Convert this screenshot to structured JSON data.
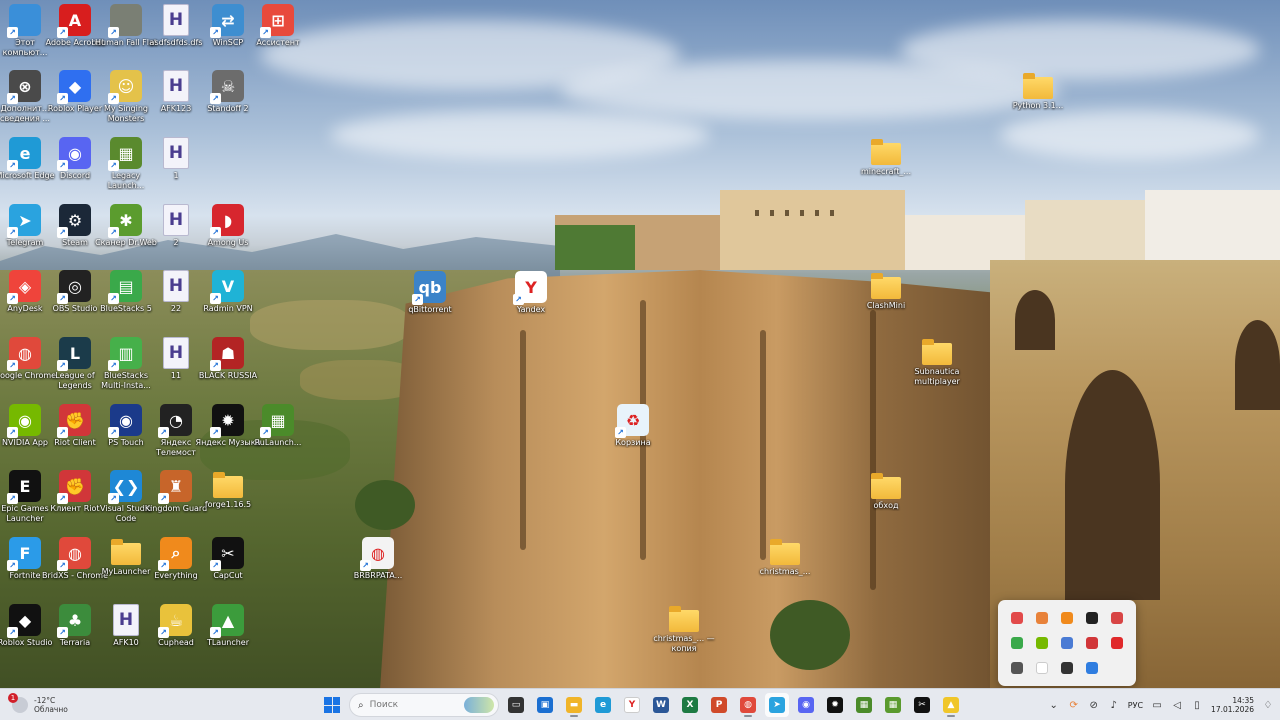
{
  "desktop": {
    "icons": [
      {
        "label": "Этот компьют...",
        "icon": "monitor-icon",
        "kind": "app",
        "color": "#3a8fd9",
        "glyph": ""
      },
      {
        "label": "Adobe Acrobat",
        "icon": "acrobat-icon",
        "kind": "app",
        "color": "#d81e1e",
        "glyph": "A"
      },
      {
        "label": "Human Fall Flat",
        "icon": "human-fall-flat-icon",
        "kind": "app",
        "color": "#7a7f74",
        "glyph": ""
      },
      {
        "label": "asdfsdfds.dfs",
        "icon": "h-file-icon",
        "kind": "hfile",
        "color": "",
        "glyph": "H"
      },
      {
        "label": "WinSCP",
        "icon": "winscp-icon",
        "kind": "app",
        "color": "#3e8ed0",
        "glyph": "⇄"
      },
      {
        "label": "Ассистент",
        "icon": "assistant-icon",
        "kind": "app",
        "color": "#e84a3c",
        "glyph": "⊞"
      },
      {
        "label": "Дополнит... сведения ...",
        "icon": "extra-info-icon",
        "kind": "app",
        "color": "#4a4a4a",
        "glyph": "⊗"
      },
      {
        "label": "Roblox Player",
        "icon": "roblox-player-icon",
        "kind": "app",
        "color": "#2f6ff0",
        "glyph": "◆"
      },
      {
        "label": "My Singing Monsters",
        "icon": "my-singing-monsters-icon",
        "kind": "app",
        "color": "#e4c24a",
        "glyph": "☺"
      },
      {
        "label": "AFK123",
        "icon": "h-file-icon",
        "kind": "hfile",
        "color": "",
        "glyph": "H"
      },
      {
        "label": "Standoff 2",
        "icon": "standoff-icon",
        "kind": "app",
        "color": "#6c6c6c",
        "glyph": "☠"
      },
      {
        "label": "Microsoft Edge",
        "icon": "edge-icon",
        "kind": "app",
        "color": "#1f9ad6",
        "glyph": "e"
      },
      {
        "label": "Discord",
        "icon": "discord-icon",
        "kind": "app",
        "color": "#5865f2",
        "glyph": "◉"
      },
      {
        "label": "Legacy Launch...",
        "icon": "legacy-launcher-icon",
        "kind": "app",
        "color": "#5a8a2e",
        "glyph": "▦"
      },
      {
        "label": "1",
        "icon": "h-file-icon",
        "kind": "hfile",
        "color": "",
        "glyph": "H"
      },
      {
        "label": "Telegram",
        "icon": "telegram-icon",
        "kind": "app",
        "color": "#2aa3df",
        "glyph": "➤"
      },
      {
        "label": "Steam",
        "icon": "steam-icon",
        "kind": "app",
        "color": "#1b2838",
        "glyph": "⚙"
      },
      {
        "label": "Сканер Dr.Web",
        "icon": "drweb-icon",
        "kind": "app",
        "color": "#5b9c2e",
        "glyph": "✱"
      },
      {
        "label": "2",
        "icon": "h-file-icon",
        "kind": "hfile",
        "color": "",
        "glyph": "H"
      },
      {
        "label": "Among Us",
        "icon": "among-us-icon",
        "kind": "app",
        "color": "#d7262e",
        "glyph": "◗"
      },
      {
        "label": "AnyDesk",
        "icon": "anydesk-icon",
        "kind": "app",
        "color": "#ef443b",
        "glyph": "◈"
      },
      {
        "label": "OBS Studio",
        "icon": "obs-icon",
        "kind": "app",
        "color": "#222",
        "glyph": "◎"
      },
      {
        "label": "BlueStacks 5",
        "icon": "bluestacks-icon",
        "kind": "app",
        "color": "#3aa94a",
        "glyph": "▤"
      },
      {
        "label": "22",
        "icon": "h-file-icon",
        "kind": "hfile",
        "color": "",
        "glyph": "H"
      },
      {
        "label": "Radmin VPN",
        "icon": "radmin-vpn-icon",
        "kind": "app",
        "color": "#1fb3d6",
        "glyph": "V"
      },
      {
        "label": "Google Chrome",
        "icon": "chrome-icon",
        "kind": "app",
        "color": "#e0493b",
        "glyph": "◍"
      },
      {
        "label": "League of Legends",
        "icon": "league-icon",
        "kind": "app",
        "color": "#1b3b4a",
        "glyph": "L"
      },
      {
        "label": "BlueStacks Multi-Insta...",
        "icon": "bluestacks-multi-icon",
        "kind": "app",
        "color": "#46b04a",
        "glyph": "▥"
      },
      {
        "label": "11",
        "icon": "h-file-icon",
        "kind": "hfile",
        "color": "",
        "glyph": "H"
      },
      {
        "label": "BLACK RUSSIA",
        "icon": "black-russia-icon",
        "kind": "app",
        "color": "#b32424",
        "glyph": "☗"
      },
      {
        "label": "NVIDIA App",
        "icon": "nvidia-icon",
        "kind": "app",
        "color": "#76b900",
        "glyph": "◉"
      },
      {
        "label": "Riot Client",
        "icon": "riot-client-icon",
        "kind": "app",
        "color": "#d13639",
        "glyph": "✊"
      },
      {
        "label": "PS Touch",
        "icon": "ps-touch-icon",
        "kind": "app",
        "color": "#1b3a8a",
        "glyph": "◉"
      },
      {
        "label": "Яндекс Телемост",
        "icon": "telemost-icon",
        "kind": "app",
        "color": "#222",
        "glyph": "◔"
      },
      {
        "label": "Яндекс Музыка",
        "icon": "yandex-music-icon",
        "kind": "app",
        "color": "#111",
        "glyph": "✹"
      },
      {
        "label": "RuLaunch...",
        "icon": "rulauncher-icon",
        "kind": "app",
        "color": "#4b8b2a",
        "glyph": "▦"
      },
      {
        "label": "Epic Games Launcher",
        "icon": "epic-games-icon",
        "kind": "app",
        "color": "#111",
        "glyph": "E"
      },
      {
        "label": "Клиент Riot",
        "icon": "riot-client-ru-icon",
        "kind": "app",
        "color": "#d13639",
        "glyph": "✊"
      },
      {
        "label": "Visual Studio Code",
        "icon": "vscode-icon",
        "kind": "app",
        "color": "#1e88d6",
        "glyph": "❮❯"
      },
      {
        "label": "Kingdom Guard",
        "icon": "kingdom-guard-icon",
        "kind": "app",
        "color": "#c7652a",
        "glyph": "♜"
      },
      {
        "label": "forge1.16.5",
        "icon": "folder-icon",
        "kind": "folder",
        "color": "",
        "glyph": ""
      },
      {
        "label": "Fortnite",
        "icon": "fortnite-icon",
        "kind": "app",
        "color": "#2b9be8",
        "glyph": "F"
      },
      {
        "label": "BridXS - Chrome",
        "icon": "chrome-bridxs-icon",
        "kind": "app",
        "color": "#e0493b",
        "glyph": "◍"
      },
      {
        "label": "MyLauncher",
        "icon": "folder-icon",
        "kind": "folder",
        "color": "",
        "glyph": ""
      },
      {
        "label": "Everything",
        "icon": "everything-icon",
        "kind": "app",
        "color": "#f08a1c",
        "glyph": "⌕"
      },
      {
        "label": "CapCut",
        "icon": "capcut-icon",
        "kind": "app",
        "color": "#111",
        "glyph": "✂"
      },
      {
        "label": "Roblox Studio",
        "icon": "roblox-studio-icon",
        "kind": "app",
        "color": "#111",
        "glyph": "◆"
      },
      {
        "label": "Terraria",
        "icon": "terraria-icon",
        "kind": "app",
        "color": "#3c8c3c",
        "glyph": "♣"
      },
      {
        "label": "AFK10",
        "icon": "h-file-icon",
        "kind": "hfile",
        "color": "",
        "glyph": "H"
      },
      {
        "label": "Cuphead",
        "icon": "cuphead-icon",
        "kind": "app",
        "color": "#e9c23b",
        "glyph": "☕"
      },
      {
        "label": "TLauncher",
        "icon": "tlauncher-icon",
        "kind": "app",
        "color": "#3c9c3c",
        "glyph": "▲"
      }
    ],
    "loose_icons": [
      {
        "label": "qBittorrent",
        "icon": "qbittorrent-icon",
        "kind": "app",
        "color": "#3b83c9",
        "glyph": "qb"
      },
      {
        "label": "Yandex",
        "icon": "yandex-browser-icon",
        "kind": "app",
        "color": "#ffffff",
        "glyph": "Y"
      },
      {
        "label": "Корзина",
        "icon": "recycle-bin-icon",
        "kind": "app",
        "color": "#e8f3fb",
        "glyph": "♻"
      },
      {
        "label": "BRBRPATA...",
        "icon": "chrome-file-icon",
        "kind": "app",
        "color": "#f3f3f3",
        "glyph": "◍"
      },
      {
        "label": "christmas_...",
        "icon": "folder-icon",
        "kind": "folder",
        "color": "",
        "glyph": ""
      },
      {
        "label": "christmas_... — копия",
        "icon": "folder-icon",
        "kind": "folder",
        "color": "",
        "glyph": ""
      },
      {
        "label": "Python 3.1...",
        "icon": "folder-icon",
        "kind": "folder",
        "color": "",
        "glyph": ""
      },
      {
        "label": "minecraft_...",
        "icon": "folder-icon",
        "kind": "folder",
        "color": "",
        "glyph": ""
      },
      {
        "label": "ClashMini",
        "icon": "folder-icon",
        "kind": "folder",
        "color": "",
        "glyph": ""
      },
      {
        "label": "Subnautica multiplayer",
        "icon": "folder-icon",
        "kind": "folder",
        "color": "",
        "glyph": ""
      },
      {
        "label": "обход",
        "icon": "folder-icon",
        "kind": "folder",
        "color": "",
        "glyph": ""
      }
    ]
  },
  "tray_popup": {
    "items": [
      {
        "icon": "record-icon",
        "color": "#e24a4a"
      },
      {
        "icon": "app-orange-icon",
        "color": "#e8823a"
      },
      {
        "icon": "search-orange-icon",
        "color": "#f08a1c"
      },
      {
        "icon": "yandex-music-tray-icon",
        "color": "#222"
      },
      {
        "icon": "shield-red-icon",
        "color": "#d84545"
      },
      {
        "icon": "stacks-icon",
        "color": "#3aa94a"
      },
      {
        "icon": "nvidia-tray-icon",
        "color": "#76b900"
      },
      {
        "icon": "dots-icon",
        "color": "#4a7bd4"
      },
      {
        "icon": "arrow-down-red-icon",
        "color": "#d13639"
      },
      {
        "icon": "opera-icon",
        "color": "#e0292b"
      },
      {
        "icon": "speaker-icon",
        "color": "#555"
      },
      {
        "icon": "yandex-tray-icon",
        "color": "#ffffff"
      },
      {
        "icon": "telegram-tray-icon",
        "color": "#333"
      },
      {
        "icon": "chrome-tray-icon",
        "color": "#2f7de0"
      }
    ]
  },
  "taskbar": {
    "weather": {
      "badge": "1",
      "temp": "-12°C",
      "condition": "Облачно"
    },
    "search": {
      "placeholder": "Поиск"
    },
    "apps": [
      {
        "icon": "task-view-icon",
        "color": "#333",
        "glyph": "▭",
        "state": ""
      },
      {
        "icon": "store-icon",
        "color": "#1b6fd1",
        "glyph": "▣",
        "state": ""
      },
      {
        "icon": "file-explorer-icon",
        "color": "#f0b429",
        "glyph": "▬",
        "state": "active"
      },
      {
        "icon": "edge-taskbar-icon",
        "color": "#1f9ad6",
        "glyph": "e",
        "state": ""
      },
      {
        "icon": "yandex-taskbar-icon",
        "color": "#ffffff",
        "glyph": "Y",
        "state": ""
      },
      {
        "icon": "word-icon",
        "color": "#2b5797",
        "glyph": "W",
        "state": ""
      },
      {
        "icon": "excel-icon",
        "color": "#1d7a43",
        "glyph": "X",
        "state": ""
      },
      {
        "icon": "powerpoint-icon",
        "color": "#d04a2a",
        "glyph": "P",
        "state": ""
      },
      {
        "icon": "chrome-taskbar-icon",
        "color": "#e0493b",
        "glyph": "◍",
        "state": "active"
      },
      {
        "icon": "telegram-taskbar-icon",
        "color": "#2aa3df",
        "glyph": "➤",
        "state": "selected"
      },
      {
        "icon": "discord-taskbar-icon",
        "color": "#5865f2",
        "glyph": "◉",
        "state": ""
      },
      {
        "icon": "yandex-music-taskbar-icon",
        "color": "#111",
        "glyph": "✹",
        "state": ""
      },
      {
        "icon": "minecraft-taskbar-icon",
        "color": "#4b8b2a",
        "glyph": "▦",
        "state": ""
      },
      {
        "icon": "minecraft2-taskbar-icon",
        "color": "#5a9a2e",
        "glyph": "▦",
        "state": ""
      },
      {
        "icon": "capcut-taskbar-icon",
        "color": "#111",
        "glyph": "✂",
        "state": ""
      },
      {
        "icon": "lock-app-taskbar-icon",
        "color": "#f0c629",
        "glyph": "▲",
        "state": "active"
      }
    ],
    "tray": {
      "lang": "РУС",
      "time": "14:35",
      "date": "17.01.2026"
    }
  }
}
